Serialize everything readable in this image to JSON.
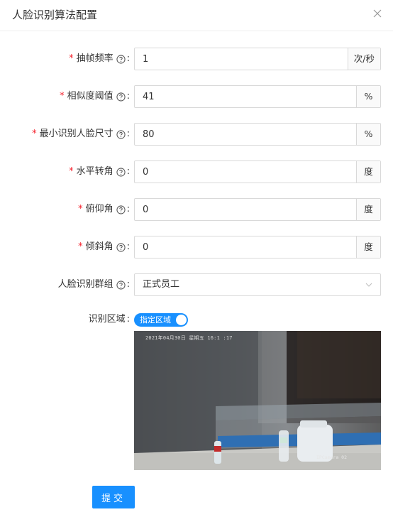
{
  "dialog": {
    "title": "人脸识别算法配置",
    "close_icon": "close-icon"
  },
  "form": {
    "frame_rate": {
      "label": "抽帧频率",
      "required": "*",
      "colon": ":",
      "value": "1",
      "unit": "次/秒"
    },
    "similarity": {
      "label": "相似度阈值",
      "required": "*",
      "colon": ":",
      "value": "41",
      "unit": "%"
    },
    "min_face_size": {
      "label": "最小识别人脸尺寸",
      "required": "*",
      "colon": ":",
      "value": "80",
      "unit": "%"
    },
    "yaw": {
      "label": "水平转角",
      "required": "*",
      "colon": ":",
      "value": "0",
      "unit": "度"
    },
    "pitch": {
      "label": "俯仰角",
      "required": "*",
      "colon": ":",
      "value": "0",
      "unit": "度"
    },
    "roll": {
      "label": "倾斜角",
      "required": "*",
      "colon": ":",
      "value": "0",
      "unit": "度"
    },
    "face_group": {
      "label": "人脸识别群组",
      "colon": ":",
      "value": "正式员工"
    },
    "region": {
      "label": "识别区域",
      "colon": ":",
      "switch_text": "指定区域",
      "switch_on": true
    }
  },
  "preview": {
    "osd_text": "2021年04月30日 星期五 16:1 :17",
    "camera_name": "IPCamera 02"
  },
  "actions": {
    "submit_label": "提交"
  },
  "colors": {
    "primary": "#1890ff",
    "required": "#f5222d",
    "border": "#d9d9d9"
  }
}
